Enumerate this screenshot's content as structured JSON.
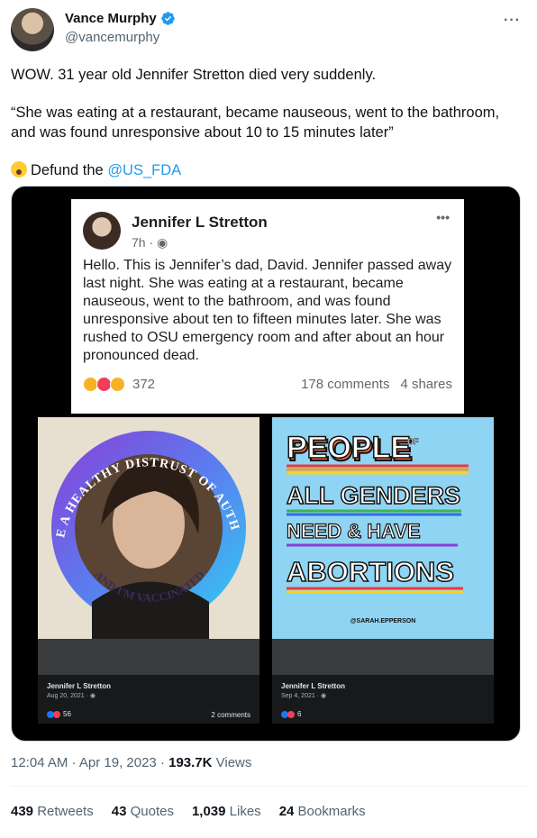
{
  "author": {
    "display_name": "Vance Murphy",
    "handle": "@vancemurphy",
    "verified": true
  },
  "tweet": {
    "line1": "WOW. 31 year old Jennifer Stretton died very suddenly.",
    "line2": "“She was eating at a restaurant, became nauseous, went to the bathroom, and was found unresponsive about 10 to 15 minutes later”",
    "line3_prefix": "Defund the ",
    "mention": "@US_FDA"
  },
  "fb_post": {
    "name": "Jennifer L Stretton",
    "time": "7h · ",
    "body": "Hello.  This is Jennifer’s dad, David.  Jennifer passed away last night.  She was eating at a restaurant, became nauseous, went to the bathroom, and was found unresponsive about ten to fifteen minutes later. She was rushed to OSU emergency room and after about an hour pronounced dead.",
    "reactions": "372",
    "comments": "178 comments",
    "shares": "4 shares"
  },
  "left_card": {
    "ring_top": "I HAVE A HEALTHY DISTRUST OF AUTHORITY",
    "ring_bottom": "AND I'M VACCINATED",
    "name": "Jennifer L Stretton",
    "date": "Aug 20, 2021 · ",
    "reactions": "56",
    "comments": "2 comments"
  },
  "right_card": {
    "line1": "PEOPLE",
    "of": "OF",
    "line2": "ALL GENDERS",
    "line3": "NEED & HAVE",
    "line4": "ABORTIONS",
    "credit": "@SARAH.EPPERSON",
    "name": "Jennifer L Stretton",
    "date": "Sep 4, 2021 · ",
    "reactions": "6"
  },
  "meta": {
    "timestamp": "12:04 AM · Apr 19, 2023 · ",
    "views_count": "193.7K",
    "views_label": " Views"
  },
  "stats": {
    "retweets_count": "439",
    "retweets_label": " Retweets",
    "quotes_count": "43",
    "quotes_label": " Quotes",
    "likes_count": "1,039",
    "likes_label": " Likes",
    "bookmarks_count": "24",
    "bookmarks_label": " Bookmarks"
  },
  "icons": {
    "more": "more-icon",
    "verified": "verified-icon",
    "emoji": "exploding-head-emoji"
  },
  "colors": {
    "accent": "#1d9bf0",
    "text": "#0f1419",
    "muted": "#536471"
  }
}
